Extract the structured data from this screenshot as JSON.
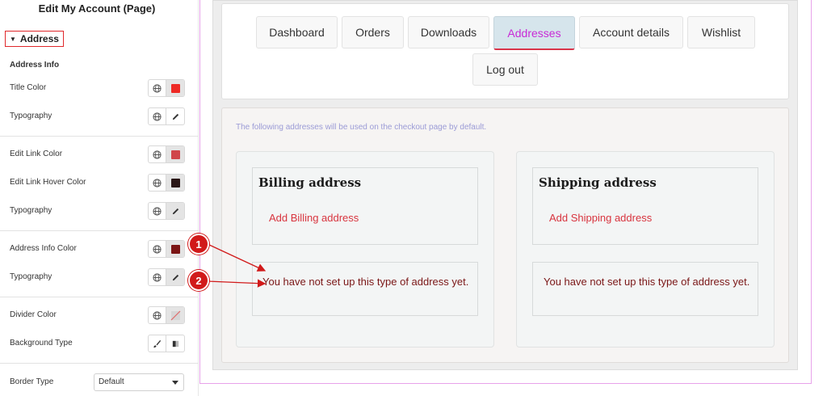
{
  "panel": {
    "title": "Edit My Account (Page)",
    "section": "Address",
    "group_label": "Address Info",
    "rows": [
      {
        "label": "Title Color",
        "control": "color",
        "swatch": "#ee2a25"
      },
      {
        "label": "Typography",
        "control": "typography"
      },
      {
        "label": "Edit Link Color",
        "control": "color",
        "swatch": "#d0454a"
      },
      {
        "label": "Edit Link Hover Color",
        "control": "color",
        "swatch": "#2a1616"
      },
      {
        "label": "Typography",
        "control": "typography"
      },
      {
        "label": "Address Info Color",
        "control": "color",
        "swatch": "#7b1515"
      },
      {
        "label": "Typography",
        "control": "typography"
      },
      {
        "label": "Divider Color",
        "control": "color-empty"
      },
      {
        "label": "Background Type",
        "control": "background"
      },
      {
        "label": "Border Type",
        "control": "select",
        "value": "Default"
      }
    ]
  },
  "nav": {
    "tabs": [
      {
        "label": "Dashboard"
      },
      {
        "label": "Orders"
      },
      {
        "label": "Downloads"
      },
      {
        "label": "Addresses",
        "active": true
      },
      {
        "label": "Account details"
      },
      {
        "label": "Wishlist"
      },
      {
        "label": "Log out"
      }
    ]
  },
  "content": {
    "notice": "The following addresses will be used on the checkout page by default.",
    "billing": {
      "title": "Billing address",
      "link": "Add Billing address",
      "message": "You have not set up this type of address yet."
    },
    "shipping": {
      "title": "Shipping address",
      "link": "Add Shipping address",
      "message": "You have not set up this type of address yet."
    }
  },
  "annotations": [
    "1",
    "2"
  ],
  "colors": {
    "accent": "#c82ad6",
    "annotation": "#d11a1a",
    "link": "#d8343e",
    "message": "#7a1616"
  }
}
